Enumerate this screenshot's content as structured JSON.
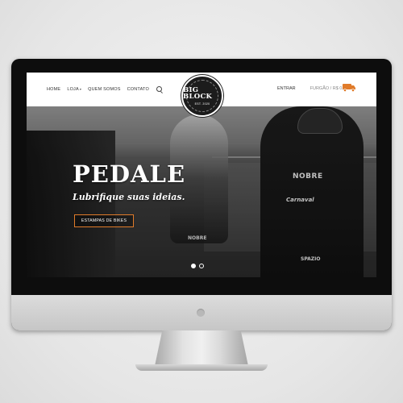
{
  "nav": {
    "home": "HOME",
    "shop": "LOJA",
    "about": "QUEM SOMOS",
    "contact": "CONTATO"
  },
  "logo": {
    "title": "BIG BLOCK",
    "subtitle": "EST. 2020"
  },
  "header_right": {
    "login": "ENTRAR",
    "cart": "FURGÃO / R$ 0,00"
  },
  "hero": {
    "title": "PEDALE",
    "subtitle": "Lubrifique suas ideias.",
    "button": "ESTAMPAS DE BIKES",
    "jersey_texts": [
      "NOBRE",
      "Carnaval",
      "SPAZIO",
      "NOBRE"
    ]
  },
  "colors": {
    "accent": "#e07b2a",
    "header_bg": "#ffffff",
    "bezel": "#0d0d0d"
  },
  "icons": {
    "search": "search-icon",
    "cart": "van-icon",
    "dropdown": "chevron-down-icon"
  }
}
